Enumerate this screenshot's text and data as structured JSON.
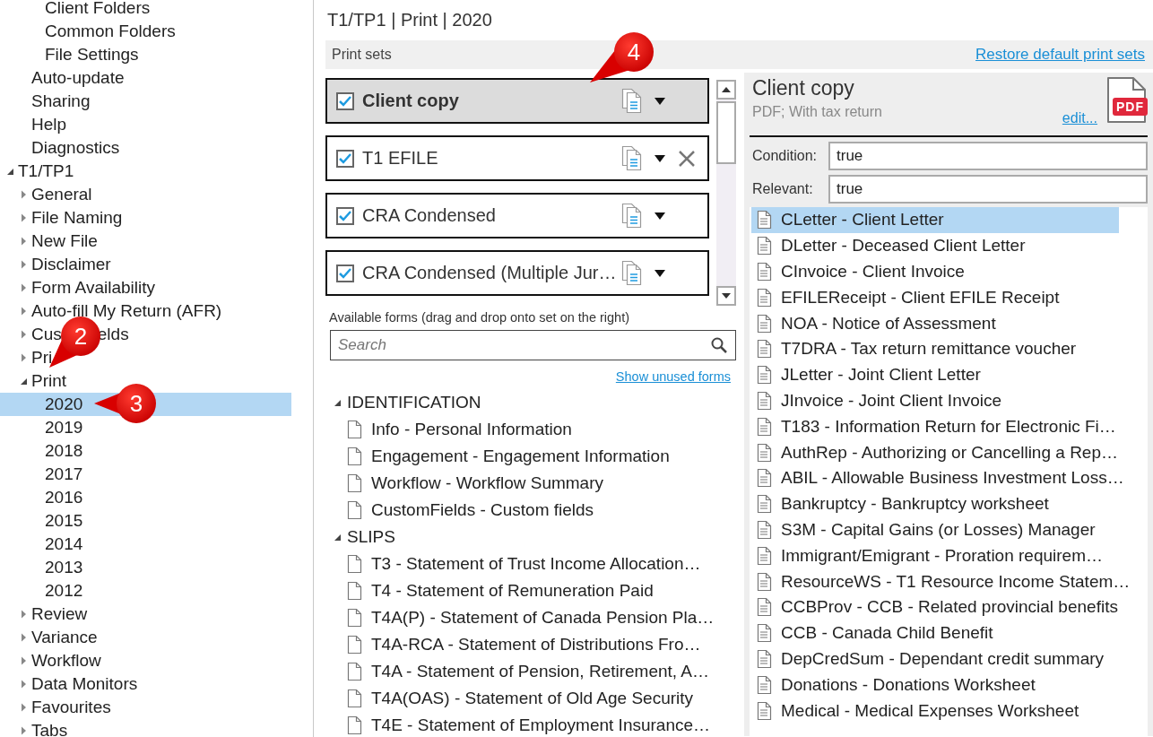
{
  "sidebar": {
    "tree": [
      {
        "children": [
          {
            "children": [
              {
                "label": "Client Folders",
                "selected": false
              },
              {
                "label": "Common Folders",
                "selected": false
              },
              {
                "label": "File Settings",
                "selected": false
              }
            ]
          },
          {
            "label": "Auto-update",
            "selected": false
          },
          {
            "label": "Sharing",
            "selected": false
          },
          {
            "label": "Help",
            "selected": false
          },
          {
            "label": "Diagnostics",
            "selected": false
          }
        ]
      },
      {
        "label": "T1/TP1",
        "selected": false,
        "expanded": true,
        "children": [
          {
            "label": "General",
            "selected": false,
            "expanded": false
          },
          {
            "label": "File Naming",
            "selected": false,
            "expanded": false
          },
          {
            "label": "New File",
            "selected": false,
            "expanded": false
          },
          {
            "label": "Disclaimer",
            "selected": false,
            "expanded": false
          },
          {
            "label": "Form Availability",
            "selected": false,
            "expanded": false
          },
          {
            "label": "Auto-fill My Return (AFR)",
            "selected": false,
            "expanded": false
          },
          {
            "label": "Cus",
            "label_after_callout": "elds",
            "selected": false,
            "expanded": false
          },
          {
            "label": "Pri",
            "selected": false,
            "expanded": false
          },
          {
            "label": "Print",
            "selected": false,
            "expanded": true,
            "children": [
              {
                "label": "2020",
                "selected": true
              },
              {
                "label": "2019",
                "selected": false
              },
              {
                "label": "2018",
                "selected": false
              },
              {
                "label": "2017",
                "selected": false
              },
              {
                "label": "2016",
                "selected": false
              },
              {
                "label": "2015",
                "selected": false
              },
              {
                "label": "2014",
                "selected": false
              },
              {
                "label": "2013",
                "selected": false
              },
              {
                "label": "2012",
                "selected": false
              }
            ]
          },
          {
            "label": "Review",
            "selected": false,
            "expanded": false
          },
          {
            "label": "Variance",
            "selected": false,
            "expanded": false
          },
          {
            "label": "Workflow",
            "selected": false,
            "expanded": false
          },
          {
            "label": "Data Monitors",
            "selected": false,
            "expanded": false
          },
          {
            "label": "Favourites",
            "selected": false,
            "expanded": false
          },
          {
            "label": "Tabs",
            "selected": false,
            "expanded": false
          }
        ]
      }
    ]
  },
  "page_title": "T1/TP1 | Print | 2020",
  "print_sets_bar": {
    "label": "Print sets",
    "restore_link": "Restore default print sets"
  },
  "print_sets": [
    {
      "name": "Client copy",
      "checked": true,
      "selected": true,
      "delete_visible": false
    },
    {
      "name": "T1 EFILE",
      "checked": true,
      "selected": false,
      "delete_visible": true
    },
    {
      "name": "CRA Condensed",
      "checked": true,
      "selected": false,
      "delete_visible": false
    },
    {
      "name": "CRA Condensed (Multiple Jur…",
      "checked": true,
      "selected": false,
      "delete_visible": false
    }
  ],
  "available_forms": {
    "caption": "Available forms (drag and drop onto set on the right)",
    "search": {
      "placeholder": "Search"
    },
    "unused_link": "Show unused forms",
    "groups": [
      {
        "label": "IDENTIFICATION",
        "expanded": true,
        "items": [
          "Info - Personal Information",
          "Engagement - Engagement Information",
          "Workflow - Workflow Summary",
          "CustomFields - Custom fields"
        ]
      },
      {
        "label": "SLIPS",
        "expanded": true,
        "items": [
          "T3 - Statement of Trust Income Allocation…",
          "T4 - Statement of Remuneration Paid",
          "T4A(P) - Statement of Canada Pension Pla…",
          "T4A-RCA - Statement of Distributions Fro…",
          "T4A - Statement of Pension, Retirement, A…",
          "T4A(OAS) - Statement of Old Age Security",
          "T4E - Statement of Employment Insurance…"
        ]
      }
    ]
  },
  "set_detail": {
    "title": "Client copy",
    "subtitle": "PDF; With tax return",
    "edit_link": "edit...",
    "badge": "PDF",
    "fields": [
      {
        "label": "Condition:",
        "value": "true"
      },
      {
        "label": "Relevant:",
        "value": "true"
      }
    ],
    "forms": [
      {
        "label": "CLetter - Client Letter",
        "selected": true
      },
      {
        "label": "DLetter - Deceased Client Letter",
        "selected": false
      },
      {
        "label": "CInvoice - Client Invoice",
        "selected": false
      },
      {
        "label": "EFILEReceipt - Client EFILE Receipt",
        "selected": false
      },
      {
        "label": "NOA - Notice of Assessment",
        "selected": false
      },
      {
        "label": "T7DRA - Tax return remittance voucher",
        "selected": false
      },
      {
        "label": "JLetter - Joint Client Letter",
        "selected": false
      },
      {
        "label": "JInvoice - Joint Client Invoice",
        "selected": false
      },
      {
        "label": "T183 - Information Return for Electronic Fi…",
        "selected": false
      },
      {
        "label": "AuthRep - Authorizing or Cancelling a Rep…",
        "selected": false
      },
      {
        "label": "ABIL - Allowable Business Investment Loss…",
        "selected": false
      },
      {
        "label": "Bankruptcy - Bankruptcy worksheet",
        "selected": false
      },
      {
        "label": "S3M - Capital Gains (or Losses) Manager",
        "selected": false
      },
      {
        "label": "Immigrant/Emigrant - Proration requirem…",
        "selected": false
      },
      {
        "label": "ResourceWS - T1 Resource Income Statem…",
        "selected": false
      },
      {
        "label": "CCBProv - CCB - Related provincial benefits",
        "selected": false
      },
      {
        "label": "CCB - Canada Child Benefit",
        "selected": false
      },
      {
        "label": "DepCredSum - Dependant credit summary",
        "selected": false
      },
      {
        "label": "Donations - Donations Worksheet",
        "selected": false
      },
      {
        "label": "Medical - Medical Expenses Worksheet",
        "selected": false
      }
    ]
  },
  "callouts": [
    {
      "number": "4"
    },
    {
      "number": "2"
    },
    {
      "number": "3"
    }
  ]
}
